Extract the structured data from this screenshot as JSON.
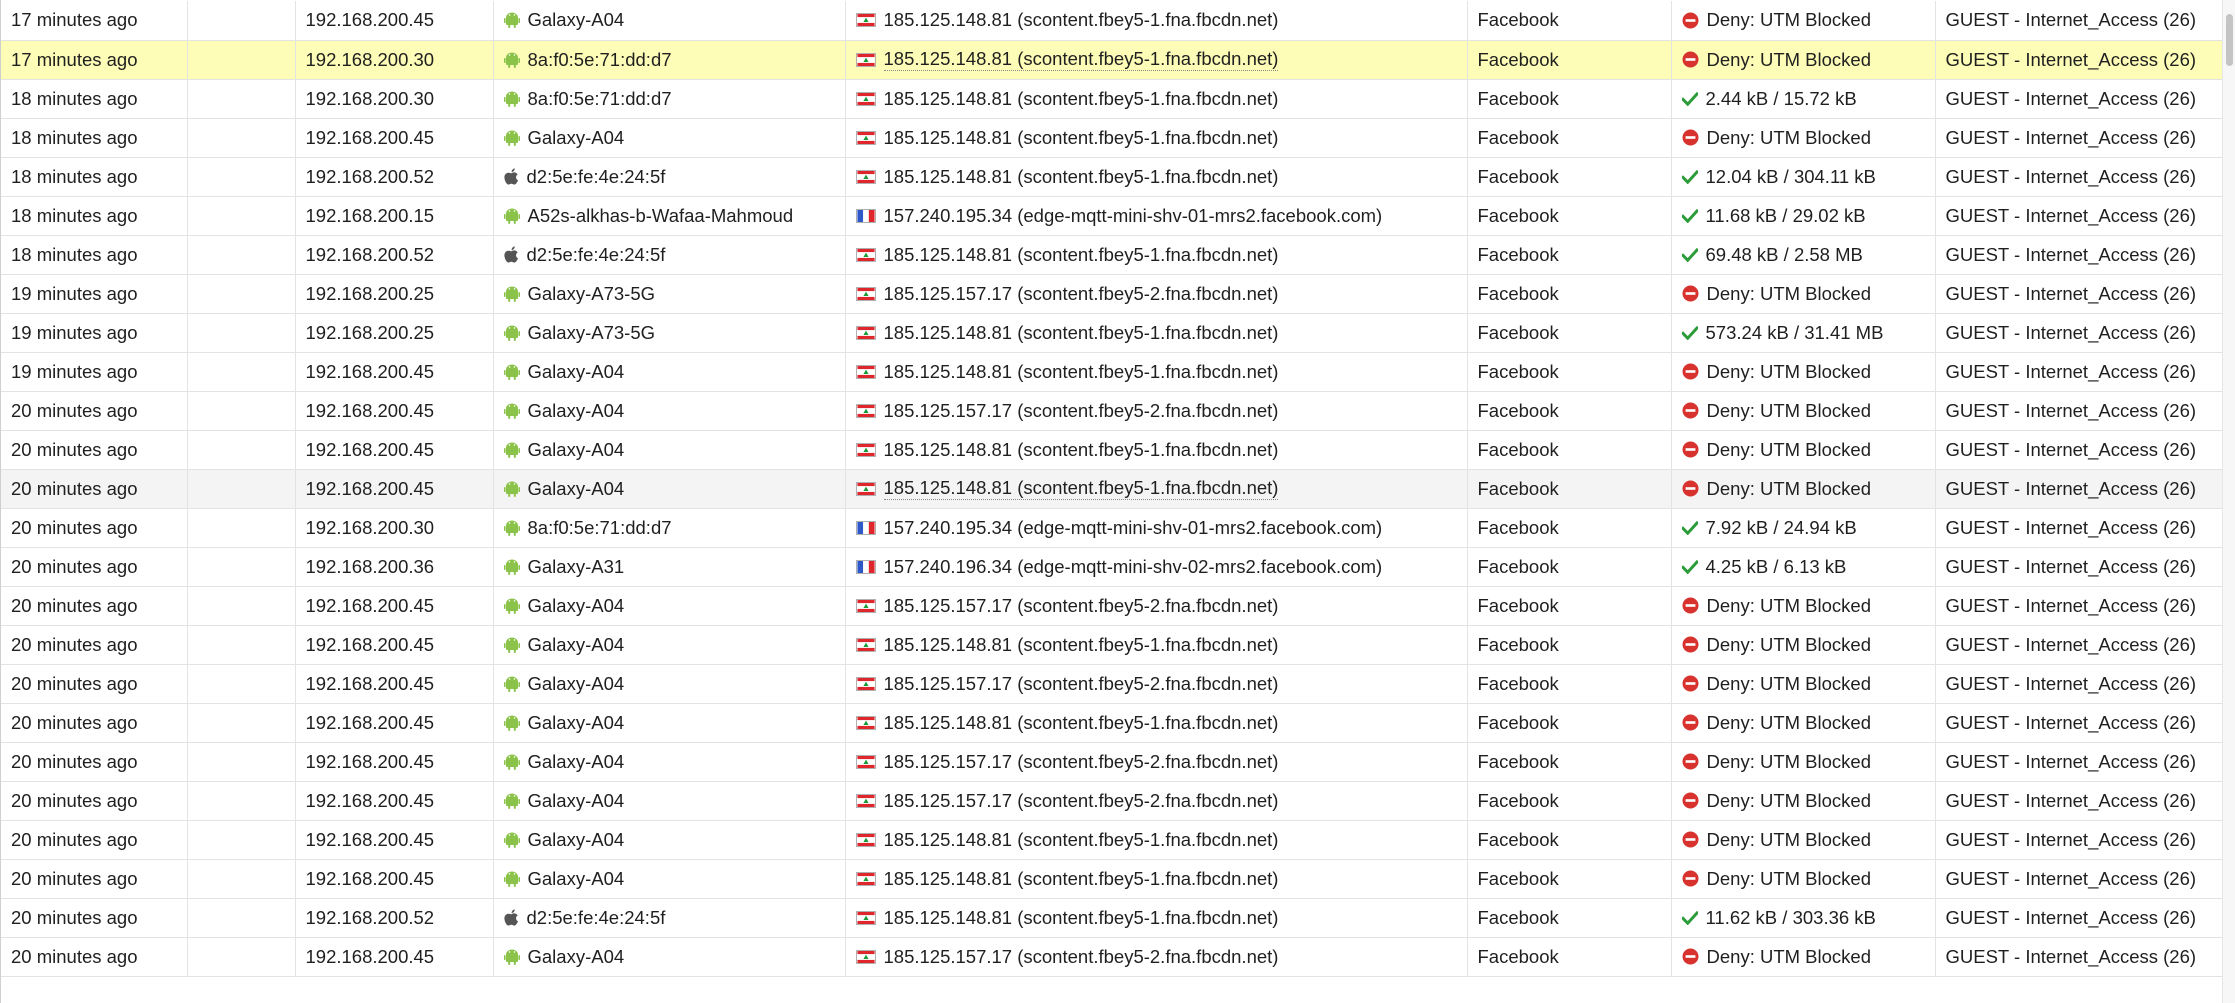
{
  "colors": {
    "selected_row": "#fdfdb8",
    "hover_row": "#f4f4f4",
    "deny_icon": "#d8322f",
    "allow_icon": "#2c9c3a",
    "android_icon": "#8bc34a",
    "apple_icon": "#555555"
  },
  "rows": [
    {
      "time": "17 minutes ago",
      "src_ip": "192.168.200.45",
      "device_icon": "android-icon",
      "device": "Galaxy-A04",
      "dest_flag": "lebanon-flag-icon",
      "dest": "185.125.148.81 (scontent.fbey5-1.fna.fbcdn.net)",
      "application": "Facebook",
      "result_icon": "deny-icon",
      "result": "Deny: UTM Blocked",
      "policy": "GUEST - Internet_Access (26)",
      "state": ""
    },
    {
      "time": "17 minutes ago",
      "src_ip": "192.168.200.30",
      "device_icon": "android-icon",
      "device": "8a:f0:5e:71:dd:d7",
      "dest_flag": "lebanon-flag-icon",
      "dest": "185.125.148.81 (scontent.fbey5-1.fna.fbcdn.net)",
      "application": "Facebook",
      "result_icon": "deny-icon",
      "result": "Deny: UTM Blocked",
      "policy": "GUEST - Internet_Access (26)",
      "state": "selected"
    },
    {
      "time": "18 minutes ago",
      "src_ip": "192.168.200.30",
      "device_icon": "android-icon",
      "device": "8a:f0:5e:71:dd:d7",
      "dest_flag": "lebanon-flag-icon",
      "dest": "185.125.148.81 (scontent.fbey5-1.fna.fbcdn.net)",
      "application": "Facebook",
      "result_icon": "allow-icon",
      "result": "2.44 kB / 15.72 kB",
      "policy": "GUEST - Internet_Access (26)",
      "state": ""
    },
    {
      "time": "18 minutes ago",
      "src_ip": "192.168.200.45",
      "device_icon": "android-icon",
      "device": "Galaxy-A04",
      "dest_flag": "lebanon-flag-icon",
      "dest": "185.125.148.81 (scontent.fbey5-1.fna.fbcdn.net)",
      "application": "Facebook",
      "result_icon": "deny-icon",
      "result": "Deny: UTM Blocked",
      "policy": "GUEST - Internet_Access (26)",
      "state": ""
    },
    {
      "time": "18 minutes ago",
      "src_ip": "192.168.200.52",
      "device_icon": "apple-icon",
      "device": "d2:5e:fe:4e:24:5f",
      "dest_flag": "lebanon-flag-icon",
      "dest": "185.125.148.81 (scontent.fbey5-1.fna.fbcdn.net)",
      "application": "Facebook",
      "result_icon": "allow-icon",
      "result": "12.04 kB / 304.11 kB",
      "policy": "GUEST - Internet_Access (26)",
      "state": ""
    },
    {
      "time": "18 minutes ago",
      "src_ip": "192.168.200.15",
      "device_icon": "android-icon",
      "device": "A52s-alkhas-b-Wafaa-Mahmoud",
      "dest_flag": "france-flag-icon",
      "dest": "157.240.195.34 (edge-mqtt-mini-shv-01-mrs2.facebook.com)",
      "application": "Facebook",
      "result_icon": "allow-icon",
      "result": "11.68 kB / 29.02 kB",
      "policy": "GUEST - Internet_Access (26)",
      "state": ""
    },
    {
      "time": "18 minutes ago",
      "src_ip": "192.168.200.52",
      "device_icon": "apple-icon",
      "device": "d2:5e:fe:4e:24:5f",
      "dest_flag": "lebanon-flag-icon",
      "dest": "185.125.148.81 (scontent.fbey5-1.fna.fbcdn.net)",
      "application": "Facebook",
      "result_icon": "allow-icon",
      "result": "69.48 kB / 2.58 MB",
      "policy": "GUEST - Internet_Access (26)",
      "state": ""
    },
    {
      "time": "19 minutes ago",
      "src_ip": "192.168.200.25",
      "device_icon": "android-icon",
      "device": "Galaxy-A73-5G",
      "dest_flag": "lebanon-flag-icon",
      "dest": "185.125.157.17 (scontent.fbey5-2.fna.fbcdn.net)",
      "application": "Facebook",
      "result_icon": "deny-icon",
      "result": "Deny: UTM Blocked",
      "policy": "GUEST - Internet_Access (26)",
      "state": ""
    },
    {
      "time": "19 minutes ago",
      "src_ip": "192.168.200.25",
      "device_icon": "android-icon",
      "device": "Galaxy-A73-5G",
      "dest_flag": "lebanon-flag-icon",
      "dest": "185.125.148.81 (scontent.fbey5-1.fna.fbcdn.net)",
      "application": "Facebook",
      "result_icon": "allow-icon",
      "result": "573.24 kB / 31.41 MB",
      "policy": "GUEST - Internet_Access (26)",
      "state": ""
    },
    {
      "time": "19 minutes ago",
      "src_ip": "192.168.200.45",
      "device_icon": "android-icon",
      "device": "Galaxy-A04",
      "dest_flag": "lebanon-flag-icon",
      "dest": "185.125.148.81 (scontent.fbey5-1.fna.fbcdn.net)",
      "application": "Facebook",
      "result_icon": "deny-icon",
      "result": "Deny: UTM Blocked",
      "policy": "GUEST - Internet_Access (26)",
      "state": ""
    },
    {
      "time": "20 minutes ago",
      "src_ip": "192.168.200.45",
      "device_icon": "android-icon",
      "device": "Galaxy-A04",
      "dest_flag": "lebanon-flag-icon",
      "dest": "185.125.157.17 (scontent.fbey5-2.fna.fbcdn.net)",
      "application": "Facebook",
      "result_icon": "deny-icon",
      "result": "Deny: UTM Blocked",
      "policy": "GUEST - Internet_Access (26)",
      "state": ""
    },
    {
      "time": "20 minutes ago",
      "src_ip": "192.168.200.45",
      "device_icon": "android-icon",
      "device": "Galaxy-A04",
      "dest_flag": "lebanon-flag-icon",
      "dest": "185.125.148.81 (scontent.fbey5-1.fna.fbcdn.net)",
      "application": "Facebook",
      "result_icon": "deny-icon",
      "result": "Deny: UTM Blocked",
      "policy": "GUEST - Internet_Access (26)",
      "state": ""
    },
    {
      "time": "20 minutes ago",
      "src_ip": "192.168.200.45",
      "device_icon": "android-icon",
      "device": "Galaxy-A04",
      "dest_flag": "lebanon-flag-icon",
      "dest": "185.125.148.81 (scontent.fbey5-1.fna.fbcdn.net)",
      "application": "Facebook",
      "result_icon": "deny-icon",
      "result": "Deny: UTM Blocked",
      "policy": "GUEST - Internet_Access (26)",
      "state": "hover"
    },
    {
      "time": "20 minutes ago",
      "src_ip": "192.168.200.30",
      "device_icon": "android-icon",
      "device": "8a:f0:5e:71:dd:d7",
      "dest_flag": "france-flag-icon",
      "dest": "157.240.195.34 (edge-mqtt-mini-shv-01-mrs2.facebook.com)",
      "application": "Facebook",
      "result_icon": "allow-icon",
      "result": "7.92 kB / 24.94 kB",
      "policy": "GUEST - Internet_Access (26)",
      "state": ""
    },
    {
      "time": "20 minutes ago",
      "src_ip": "192.168.200.36",
      "device_icon": "android-icon",
      "device": "Galaxy-A31",
      "dest_flag": "france-flag-icon",
      "dest": "157.240.196.34 (edge-mqtt-mini-shv-02-mrs2.facebook.com)",
      "application": "Facebook",
      "result_icon": "allow-icon",
      "result": "4.25 kB / 6.13 kB",
      "policy": "GUEST - Internet_Access (26)",
      "state": ""
    },
    {
      "time": "20 minutes ago",
      "src_ip": "192.168.200.45",
      "device_icon": "android-icon",
      "device": "Galaxy-A04",
      "dest_flag": "lebanon-flag-icon",
      "dest": "185.125.157.17 (scontent.fbey5-2.fna.fbcdn.net)",
      "application": "Facebook",
      "result_icon": "deny-icon",
      "result": "Deny: UTM Blocked",
      "policy": "GUEST - Internet_Access (26)",
      "state": ""
    },
    {
      "time": "20 minutes ago",
      "src_ip": "192.168.200.45",
      "device_icon": "android-icon",
      "device": "Galaxy-A04",
      "dest_flag": "lebanon-flag-icon",
      "dest": "185.125.148.81 (scontent.fbey5-1.fna.fbcdn.net)",
      "application": "Facebook",
      "result_icon": "deny-icon",
      "result": "Deny: UTM Blocked",
      "policy": "GUEST - Internet_Access (26)",
      "state": ""
    },
    {
      "time": "20 minutes ago",
      "src_ip": "192.168.200.45",
      "device_icon": "android-icon",
      "device": "Galaxy-A04",
      "dest_flag": "lebanon-flag-icon",
      "dest": "185.125.157.17 (scontent.fbey5-2.fna.fbcdn.net)",
      "application": "Facebook",
      "result_icon": "deny-icon",
      "result": "Deny: UTM Blocked",
      "policy": "GUEST - Internet_Access (26)",
      "state": ""
    },
    {
      "time": "20 minutes ago",
      "src_ip": "192.168.200.45",
      "device_icon": "android-icon",
      "device": "Galaxy-A04",
      "dest_flag": "lebanon-flag-icon",
      "dest": "185.125.148.81 (scontent.fbey5-1.fna.fbcdn.net)",
      "application": "Facebook",
      "result_icon": "deny-icon",
      "result": "Deny: UTM Blocked",
      "policy": "GUEST - Internet_Access (26)",
      "state": ""
    },
    {
      "time": "20 minutes ago",
      "src_ip": "192.168.200.45",
      "device_icon": "android-icon",
      "device": "Galaxy-A04",
      "dest_flag": "lebanon-flag-icon",
      "dest": "185.125.157.17 (scontent.fbey5-2.fna.fbcdn.net)",
      "application": "Facebook",
      "result_icon": "deny-icon",
      "result": "Deny: UTM Blocked",
      "policy": "GUEST - Internet_Access (26)",
      "state": ""
    },
    {
      "time": "20 minutes ago",
      "src_ip": "192.168.200.45",
      "device_icon": "android-icon",
      "device": "Galaxy-A04",
      "dest_flag": "lebanon-flag-icon",
      "dest": "185.125.157.17 (scontent.fbey5-2.fna.fbcdn.net)",
      "application": "Facebook",
      "result_icon": "deny-icon",
      "result": "Deny: UTM Blocked",
      "policy": "GUEST - Internet_Access (26)",
      "state": ""
    },
    {
      "time": "20 minutes ago",
      "src_ip": "192.168.200.45",
      "device_icon": "android-icon",
      "device": "Galaxy-A04",
      "dest_flag": "lebanon-flag-icon",
      "dest": "185.125.148.81 (scontent.fbey5-1.fna.fbcdn.net)",
      "application": "Facebook",
      "result_icon": "deny-icon",
      "result": "Deny: UTM Blocked",
      "policy": "GUEST - Internet_Access (26)",
      "state": ""
    },
    {
      "time": "20 minutes ago",
      "src_ip": "192.168.200.45",
      "device_icon": "android-icon",
      "device": "Galaxy-A04",
      "dest_flag": "lebanon-flag-icon",
      "dest": "185.125.148.81 (scontent.fbey5-1.fna.fbcdn.net)",
      "application": "Facebook",
      "result_icon": "deny-icon",
      "result": "Deny: UTM Blocked",
      "policy": "GUEST - Internet_Access (26)",
      "state": ""
    },
    {
      "time": "20 minutes ago",
      "src_ip": "192.168.200.52",
      "device_icon": "apple-icon",
      "device": "d2:5e:fe:4e:24:5f",
      "dest_flag": "lebanon-flag-icon",
      "dest": "185.125.148.81 (scontent.fbey5-1.fna.fbcdn.net)",
      "application": "Facebook",
      "result_icon": "allow-icon",
      "result": "11.62 kB / 303.36 kB",
      "policy": "GUEST - Internet_Access (26)",
      "state": ""
    },
    {
      "time": "20 minutes ago",
      "src_ip": "192.168.200.45",
      "device_icon": "android-icon",
      "device": "Galaxy-A04",
      "dest_flag": "lebanon-flag-icon",
      "dest": "185.125.157.17 (scontent.fbey5-2.fna.fbcdn.net)",
      "application": "Facebook",
      "result_icon": "deny-icon",
      "result": "Deny: UTM Blocked",
      "policy": "GUEST - Internet_Access (26)",
      "state": ""
    }
  ]
}
